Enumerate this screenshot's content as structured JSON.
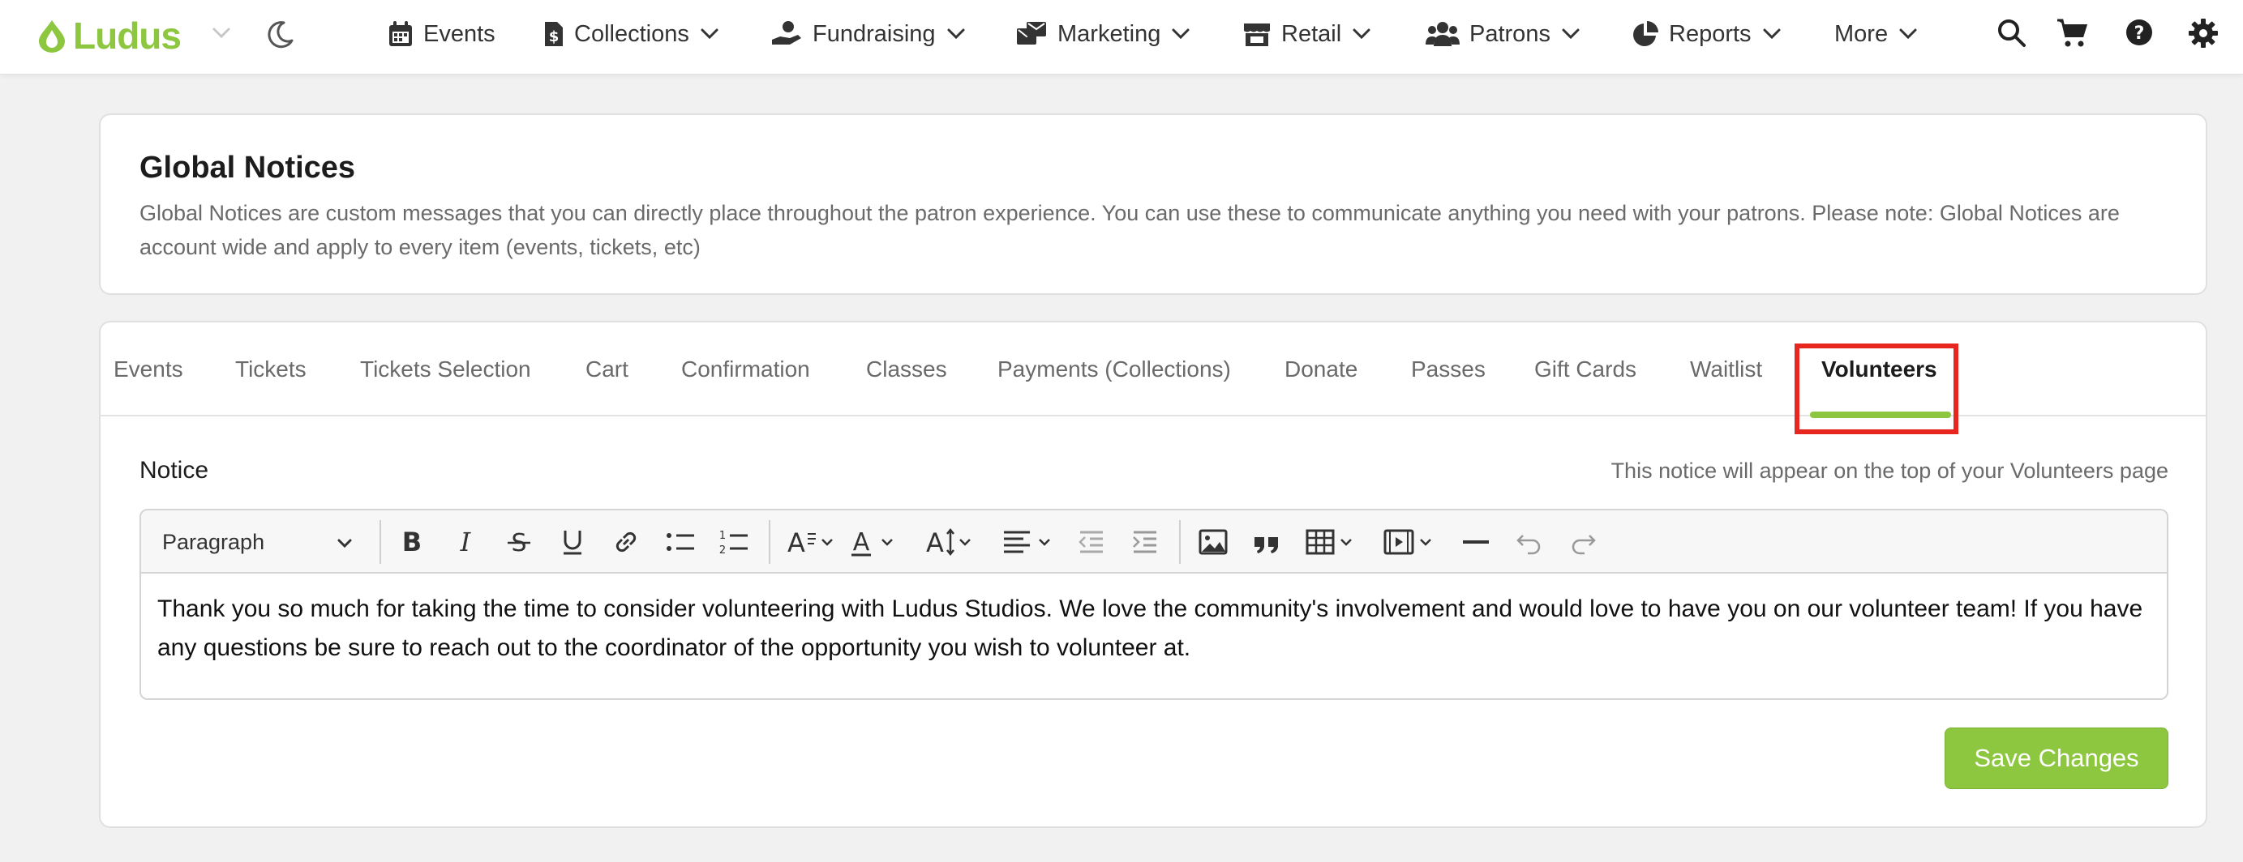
{
  "brand": {
    "logo_text": "Ludus",
    "accent": "#8dc63f"
  },
  "nav": {
    "items": [
      {
        "label": "Events",
        "icon": "calendar-icon"
      },
      {
        "label": "Collections",
        "icon": "dollar-document-icon"
      },
      {
        "label": "Fundraising",
        "icon": "hand-coin-icon"
      },
      {
        "label": "Marketing",
        "icon": "mail-bulk-icon"
      },
      {
        "label": "Retail",
        "icon": "store-icon"
      },
      {
        "label": "Patrons",
        "icon": "users-icon"
      },
      {
        "label": "Reports",
        "icon": "pie-chart-icon"
      },
      {
        "label": "More",
        "icon": "chevron-down-icon"
      }
    ],
    "right_icons": [
      "search-icon",
      "cart-icon",
      "help-icon",
      "gear-icon"
    ]
  },
  "global_notices": {
    "title": "Global Notices",
    "description": "Global Notices are custom messages that you can directly place throughout the patron experience. You can use these to communicate anything you need with your patrons. Please note: Global Notices are account wide and apply to every item (events, tickets, etc)"
  },
  "tabs": [
    {
      "label": "Events"
    },
    {
      "label": "Tickets"
    },
    {
      "label": "Tickets Selection"
    },
    {
      "label": "Cart"
    },
    {
      "label": "Confirmation"
    },
    {
      "label": "Classes"
    },
    {
      "label": "Payments (Collections)"
    },
    {
      "label": "Donate"
    },
    {
      "label": "Passes"
    },
    {
      "label": "Gift Cards"
    },
    {
      "label": "Waitlist"
    },
    {
      "label": "Volunteers",
      "active": true
    }
  ],
  "notice": {
    "label": "Notice",
    "hint": "This notice will appear on the top of your Volunteers page",
    "format_select": "Paragraph",
    "content": "Thank you so much for taking the time to consider volunteering with Ludus Studios. We love the community's involvement and would love to have you on our volunteer team! If you have any questions be sure to reach out to the coordinator of the opportunity you wish to volunteer at."
  },
  "actions": {
    "save_label": "Save Changes"
  },
  "colors": {
    "highlight": "#e6261f",
    "save_button": "#8dc63f"
  }
}
